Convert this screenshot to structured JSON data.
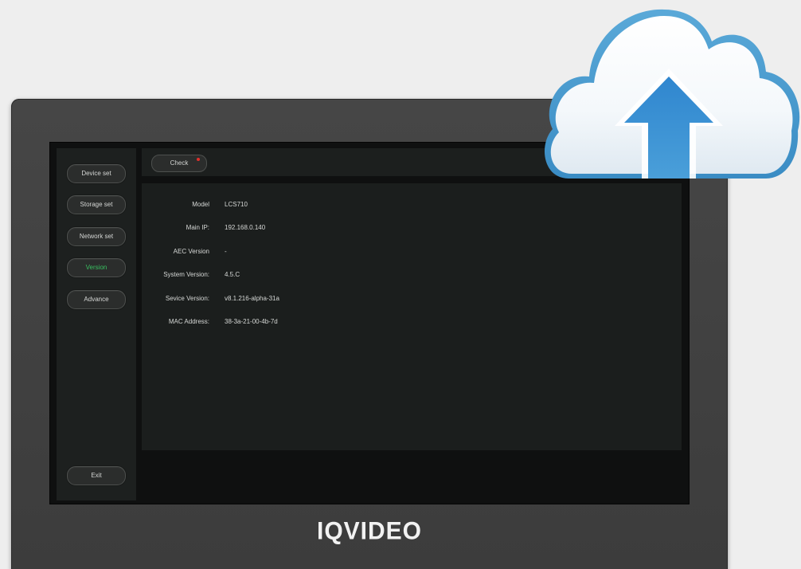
{
  "sidebar": {
    "items": [
      {
        "label": "Device set"
      },
      {
        "label": "Storage set"
      },
      {
        "label": "Network set"
      },
      {
        "label": "Version",
        "active": true
      },
      {
        "label": "Advance"
      }
    ],
    "exit_label": "Exit"
  },
  "toolbar": {
    "check_label": "Check"
  },
  "info": [
    {
      "label": "Model",
      "value": "LCS710"
    },
    {
      "label": "Main IP:",
      "value": "192.168.0.140"
    },
    {
      "label": "AEC Version",
      "value": "-"
    },
    {
      "label": "System Version:",
      "value": "4.5.C"
    },
    {
      "label": "Sevice Version:",
      "value": "v8.1.216-alpha-31a"
    },
    {
      "label": "MAC Address:",
      "value": "38-3a-21-00-4b-7d"
    }
  ],
  "brand": {
    "logo_text": "IQVIDEO"
  },
  "icons": {
    "cloud": "cloud-upload-icon",
    "notification": "red-dot-indicator"
  },
  "colors": {
    "active_nav": "#39c060",
    "notification_dot": "#e0302c",
    "arrow_blue": "#2f86cf"
  }
}
